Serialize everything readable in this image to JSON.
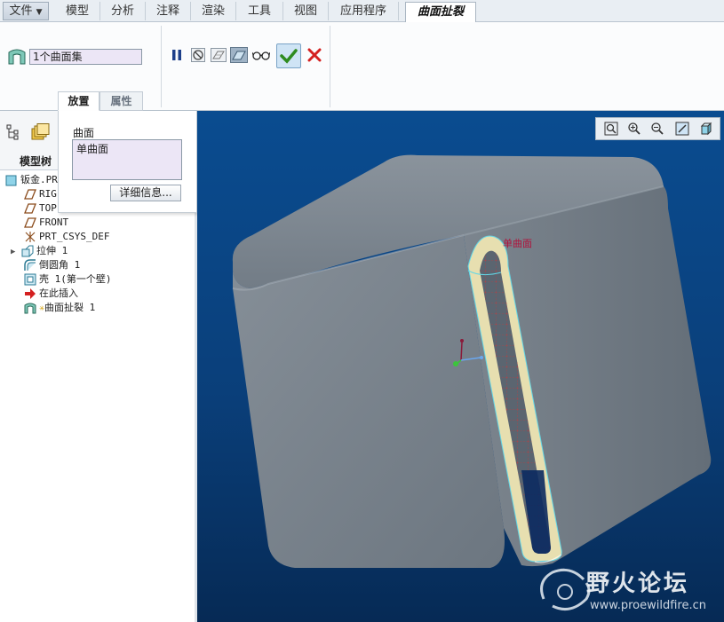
{
  "menubar": {
    "file": "文件",
    "tabs": [
      "模型",
      "分析",
      "注释",
      "渲染",
      "工具",
      "视图",
      "应用程序"
    ],
    "active_tab": "曲面扯裂"
  },
  "ribbon": {
    "surface_collector": "1个曲面集",
    "subtabs": [
      "放置",
      "属性"
    ]
  },
  "flyout": {
    "label": "曲面",
    "item": "单曲面",
    "details_button": "详细信息..."
  },
  "tree": {
    "title": "模型树",
    "items": [
      {
        "label": "钣金.PR",
        "icon": "part-icon"
      },
      {
        "label": "RIG",
        "icon": "datum-plane-icon"
      },
      {
        "label": "TOP",
        "icon": "datum-plane-icon"
      },
      {
        "label": "FRONT",
        "icon": "datum-plane-icon"
      },
      {
        "label": "PRT_CSYS_DEF",
        "icon": "csys-icon"
      },
      {
        "label": "拉伸 1",
        "icon": "extrude-icon"
      },
      {
        "label": "倒圆角 1",
        "icon": "round-icon"
      },
      {
        "label": "壳 1(第一个壁)",
        "icon": "shell-icon"
      },
      {
        "label": "在此插入",
        "icon": "insert-here-icon"
      },
      {
        "label": "曲面扯裂 1",
        "icon": "surface-rip-icon"
      }
    ]
  },
  "viewport": {
    "annotation": "单曲面",
    "watermark_title": "野火论坛",
    "watermark_url": "www.proewildfire.cn"
  },
  "colors": {
    "viewport_top": "#0a4c90",
    "viewport_bottom": "#062a55",
    "accept": "#2e8b1f",
    "cancel": "#d42020",
    "annotation": "#b0103a"
  }
}
